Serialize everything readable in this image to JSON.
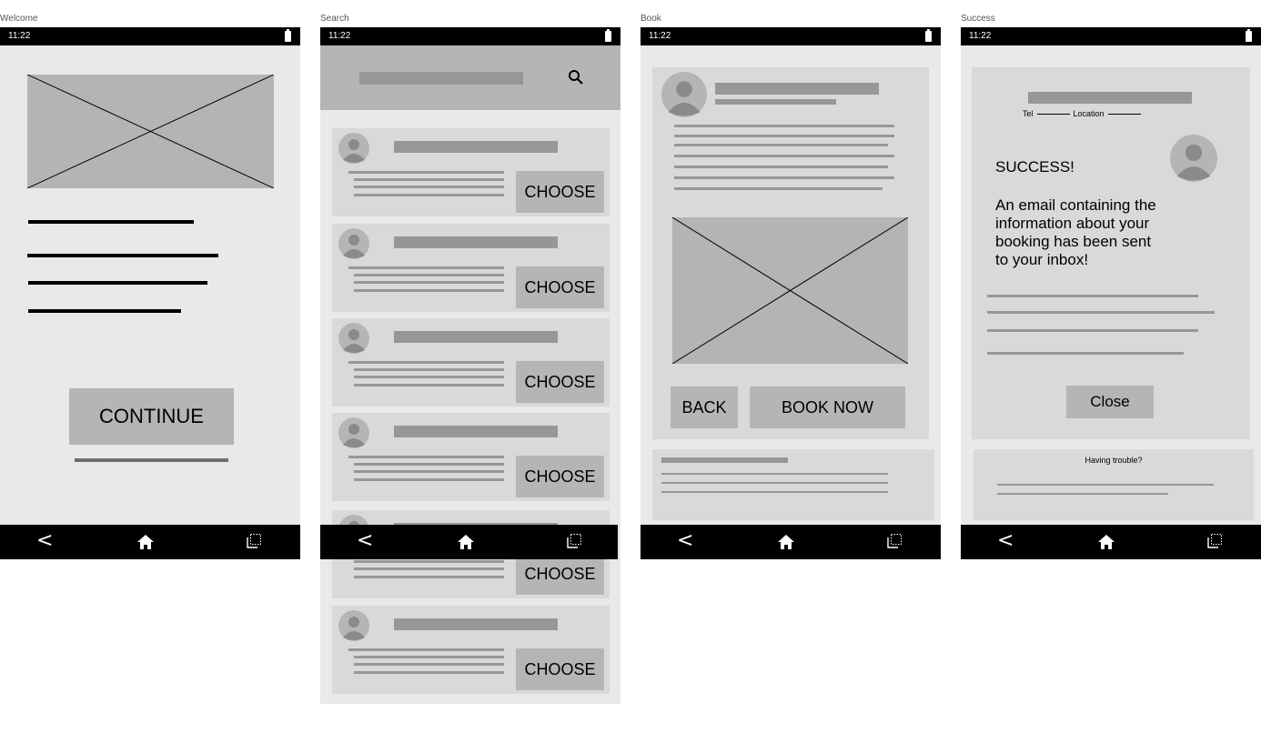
{
  "frames": {
    "welcome": {
      "label": "Welcome",
      "time": "11:22",
      "continue_label": "CONTINUE"
    },
    "search": {
      "label": "Search",
      "time": "11:22",
      "choose_label": "CHOOSE"
    },
    "book": {
      "label": "Book",
      "time": "11:22",
      "back_label": "BACK",
      "book_now_label": "BOOK NOW"
    },
    "success": {
      "label": "Success",
      "time": "11:22",
      "tel_label": "Tel",
      "location_label": "Location",
      "heading": "SUCCESS!",
      "message_lines": [
        "An email containing the",
        "information about your",
        "booking has been sent",
        "to your inbox!"
      ],
      "close_label": "Close",
      "trouble_text": "Having trouble?"
    }
  },
  "icons": {
    "back": "chevron-left-icon",
    "home": "home-icon",
    "recents": "recents-icon",
    "search": "search-icon",
    "avatar": "avatar-icon",
    "battery": "battery-icon"
  },
  "colors": {
    "screen_bg": "#e9e9e9",
    "card_bg": "#d9d9d9",
    "placeholder": "#b5b5b5",
    "bar": "#979797"
  }
}
